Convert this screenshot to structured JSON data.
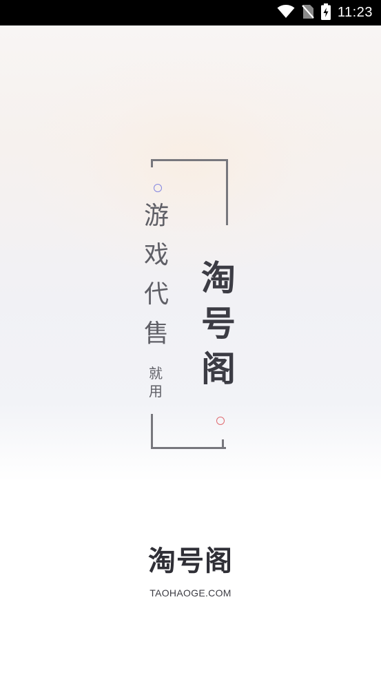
{
  "status_bar": {
    "time": "11:23",
    "icons": [
      "wifi-icon",
      "no-sim-icon",
      "battery-charging-icon"
    ]
  },
  "splash": {
    "slogan_chars": [
      "游",
      "戏",
      "代",
      "售"
    ],
    "small_chars": [
      "就",
      "用"
    ],
    "brand_chars": [
      "淘",
      "号",
      "阁"
    ],
    "logo": "淘号阁",
    "domain": "TAOHAOGE.COM"
  },
  "colors": {
    "accent_blue": "#8486e0",
    "accent_red": "#e06a70",
    "frame_gray": "#77777d",
    "text_dark": "#3c3c44"
  }
}
